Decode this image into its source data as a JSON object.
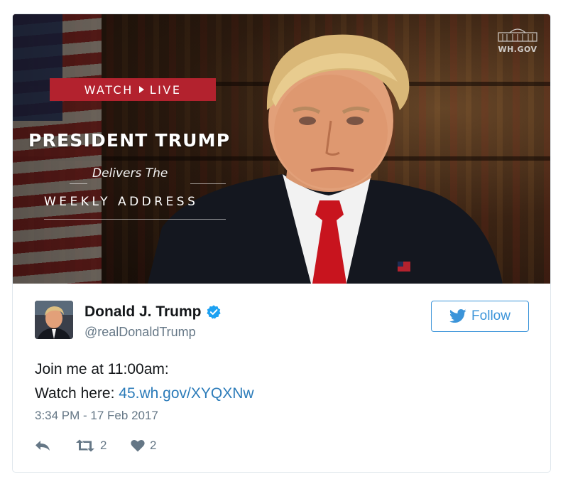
{
  "media": {
    "badge_watch": "WATCH",
    "badge_live": "LIVE",
    "title_main": "PRESIDENT TRUMP",
    "title_sub": "Delivers The",
    "title_weekly": "WEEKLY ADDRESS",
    "logo_text": "WH.GOV",
    "badge_color": "#b3222e"
  },
  "author": {
    "name": "Donald J. Trump",
    "handle": "@realDonaldTrump",
    "verified_icon": "verified-badge-icon"
  },
  "follow": {
    "label": "Follow",
    "icon": "twitter-bird-icon",
    "color": "#3b94d9"
  },
  "tweet": {
    "line1": "Join me at 11:00am:",
    "line2_prefix": "Watch here: ",
    "link": "45.wh.gov/XYQXNw",
    "timestamp": "3:34 PM - 17 Feb 2017",
    "link_color": "#2b7bb9"
  },
  "actions": {
    "reply_icon": "reply-icon",
    "retweet_icon": "retweet-icon",
    "retweet_count": "2",
    "like_icon": "heart-icon",
    "like_count": "2"
  }
}
